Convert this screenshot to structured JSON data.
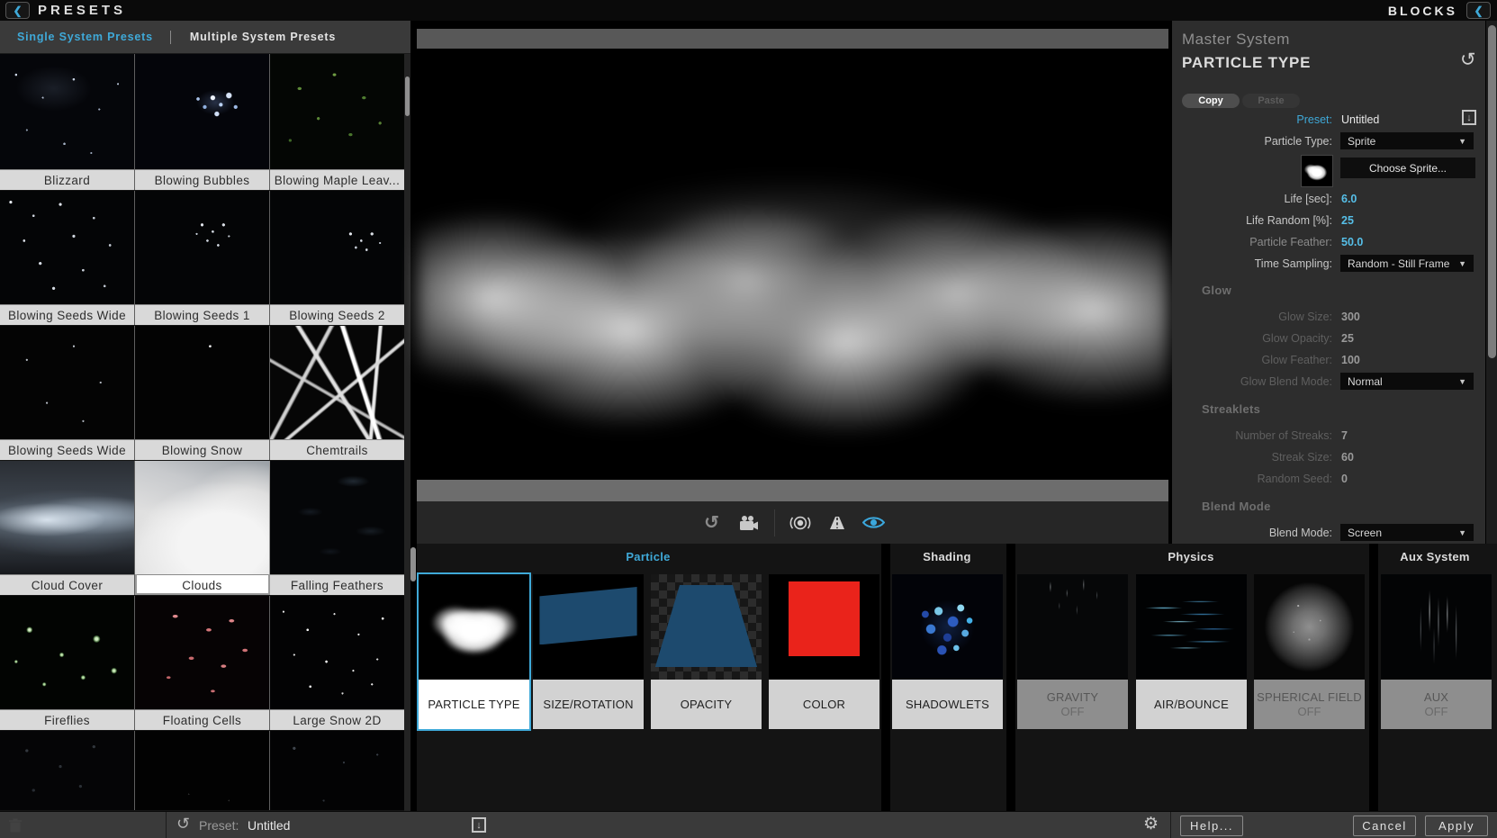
{
  "header": {
    "title": "PRESETS",
    "blocks_label": "BLOCKS"
  },
  "icons": {
    "back_chevron": "❮",
    "dropdown_arrow": "▼",
    "reset": "↺",
    "save_arrow": "↓",
    "gear": "⚙"
  },
  "colors": {
    "accent": "#3fa9d8",
    "value_text": "#56bfe8",
    "selected_border": "#3fa9d8"
  },
  "sidebar": {
    "tabs": [
      {
        "label": "Single System Presets",
        "active": true
      },
      {
        "label": "Multiple System Presets",
        "active": false
      }
    ],
    "presets": [
      {
        "name": "Blizzard"
      },
      {
        "name": "Blowing Bubbles"
      },
      {
        "name": "Blowing Maple Leav..."
      },
      {
        "name": "Blowing Seeds Wide"
      },
      {
        "name": "Blowing Seeds 1"
      },
      {
        "name": "Blowing Seeds 2"
      },
      {
        "name": "Blowing Seeds Wide"
      },
      {
        "name": "Blowing Snow"
      },
      {
        "name": "Chemtrails"
      },
      {
        "name": "Cloud Cover"
      },
      {
        "name": "Clouds",
        "selected": true
      },
      {
        "name": "Falling Feathers"
      },
      {
        "name": "Fireflies"
      },
      {
        "name": "Floating Cells"
      },
      {
        "name": "Large Snow 2D"
      }
    ]
  },
  "panel": {
    "system_label": "Master System",
    "title": "PARTICLE TYPE",
    "copy_label": "Copy",
    "paste_label": "Paste",
    "preset_label": "Preset:",
    "preset_value": "Untitled",
    "particle_type_label": "Particle Type:",
    "particle_type_value": "Sprite",
    "choose_sprite_label": "Choose Sprite...",
    "life_label": "Life [sec]:",
    "life_value": "6.0",
    "life_random_label": "Life Random [%]:",
    "life_random_value": "25",
    "feather_label": "Particle Feather:",
    "feather_value": "50.0",
    "time_sampling_label": "Time Sampling:",
    "time_sampling_value": "Random - Still Frame",
    "glow_heading": "Glow",
    "glow_size_label": "Glow Size:",
    "glow_size_value": "300",
    "glow_opacity_label": "Glow Opacity:",
    "glow_opacity_value": "25",
    "glow_feather_label": "Glow Feather:",
    "glow_feather_value": "100",
    "glow_blend_label": "Glow Blend Mode:",
    "glow_blend_value": "Normal",
    "streaklets_heading": "Streaklets",
    "streaks_label": "Number of Streaks:",
    "streaks_value": "7",
    "streak_size_label": "Streak Size:",
    "streak_size_value": "60",
    "random_seed_label": "Random Seed:",
    "random_seed_value": "0",
    "blend_heading": "Blend Mode",
    "blend_label": "Blend Mode:",
    "blend_value": "Screen"
  },
  "blocks": {
    "groups": [
      {
        "label": "Particle",
        "active": true
      },
      {
        "label": "Shading"
      },
      {
        "label": "Physics"
      },
      {
        "label": "Aux System"
      }
    ],
    "cards": [
      {
        "label": "PARTICLE TYPE",
        "selected": true
      },
      {
        "label": "SIZE/ROTATION"
      },
      {
        "label": "OPACITY"
      },
      {
        "label": "COLOR"
      },
      {
        "label": "SHADOWLETS"
      },
      {
        "label": "GRAVITY",
        "state": "OFF"
      },
      {
        "label": "AIR/BOUNCE"
      },
      {
        "label": "SPHERICAL FIELD",
        "state": "OFF"
      },
      {
        "label": "AUX",
        "state": "OFF"
      }
    ]
  },
  "footer": {
    "preset_label": "Preset:",
    "preset_value": "Untitled",
    "help_label": "Help...",
    "cancel_label": "Cancel",
    "apply_label": "Apply"
  }
}
